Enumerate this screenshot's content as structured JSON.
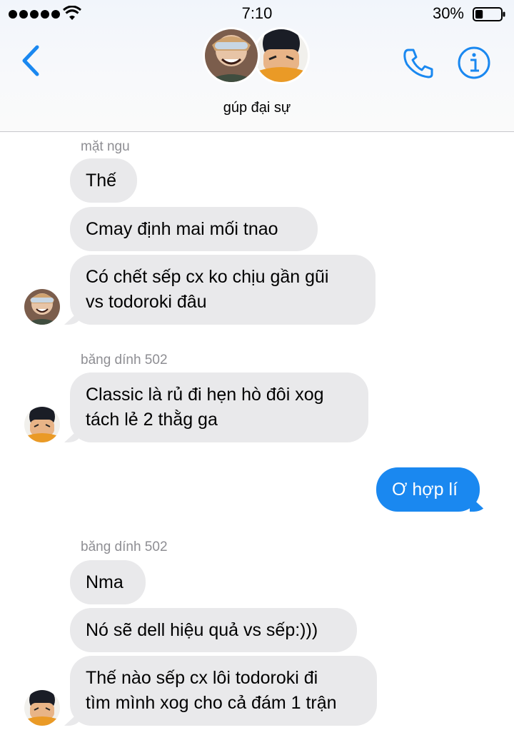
{
  "status_bar": {
    "time": "7:10",
    "battery_percent": "30%",
    "battery_level": 0.3,
    "signal_bars": 5
  },
  "header": {
    "group_name": "gúp đại sự",
    "icons": [
      "back-chevron-icon",
      "phone-icon",
      "info-icon"
    ],
    "accent_color": "#1a88f0"
  },
  "messages": [
    {
      "sender": "mặt ngu",
      "direction": "incoming",
      "bubbles": [
        "Thế",
        "Cmay định mai mối tnao",
        [
          "Có chết sếp cx ko chịu gần gũi",
          "vs todoroki đâu"
        ]
      ]
    },
    {
      "sender": "băng dính 502",
      "direction": "incoming",
      "bubbles": [
        [
          "Classic là rủ đi hẹn hò đôi xog",
          "tách lẻ 2 thằg ga"
        ]
      ]
    },
    {
      "sender": "",
      "direction": "outgoing",
      "bubbles": [
        "Ơ hợp lí"
      ]
    },
    {
      "sender": "băng dính 502",
      "direction": "incoming",
      "bubbles": [
        "Nma",
        "Nó sẽ dell hiệu quả vs sếp:)))",
        [
          "Thế nào sếp cx lôi todoroki đi",
          "tìm mình xog cho cả đám 1 trận"
        ]
      ]
    }
  ],
  "colors": {
    "incoming_bubble": "#e9e9eb",
    "outgoing_bubble": "#1a88f0",
    "sender_name": "#8e8e93"
  }
}
